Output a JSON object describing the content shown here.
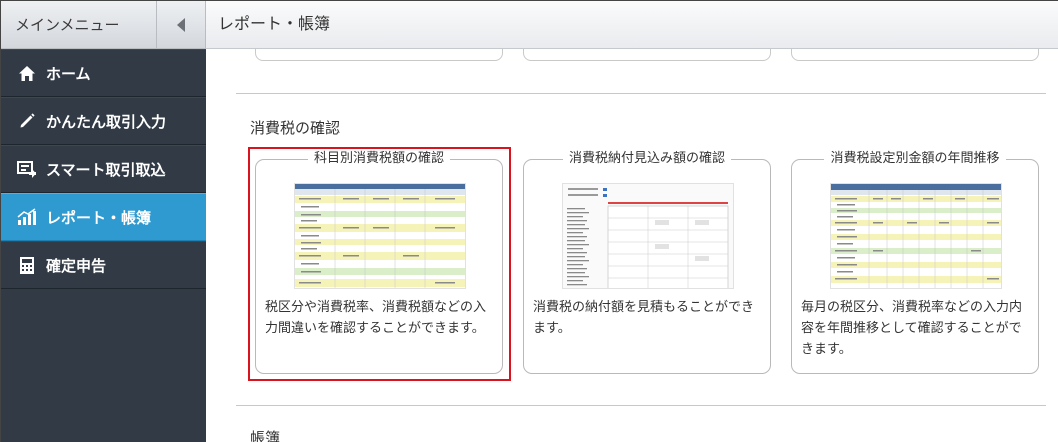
{
  "header": {
    "menu_title": "メインメニュー",
    "page_title": "レポート・帳簿"
  },
  "sidebar": {
    "items": [
      {
        "label": "ホーム",
        "icon": "home-icon"
      },
      {
        "label": "かんたん取引入力",
        "icon": "pencil-icon"
      },
      {
        "label": "スマート取引取込",
        "icon": "import-icon"
      },
      {
        "label": "レポート・帳簿",
        "icon": "chart-icon",
        "active": true
      },
      {
        "label": "確定申告",
        "icon": "calculator-icon"
      }
    ]
  },
  "main": {
    "section_consumption_tax": "消費税の確認",
    "cards": [
      {
        "title": "科目別消費税額の確認",
        "desc": "税区分や消費税率、消費税額などの入力間違いを確認することができます。"
      },
      {
        "title": "消費税納付見込み額の確認",
        "desc": "消費税の納付額を見積もることができます。"
      },
      {
        "title": "消費税設定別金額の年間推移",
        "desc": "毎月の税区分、消費税率などの入力内容を年間推移として確認することができます。"
      }
    ],
    "section_books": "帳簿"
  },
  "colors": {
    "sidebar_bg": "#313a45",
    "active_item": "#2e9ad0",
    "highlight_border": "#d9141e"
  }
}
